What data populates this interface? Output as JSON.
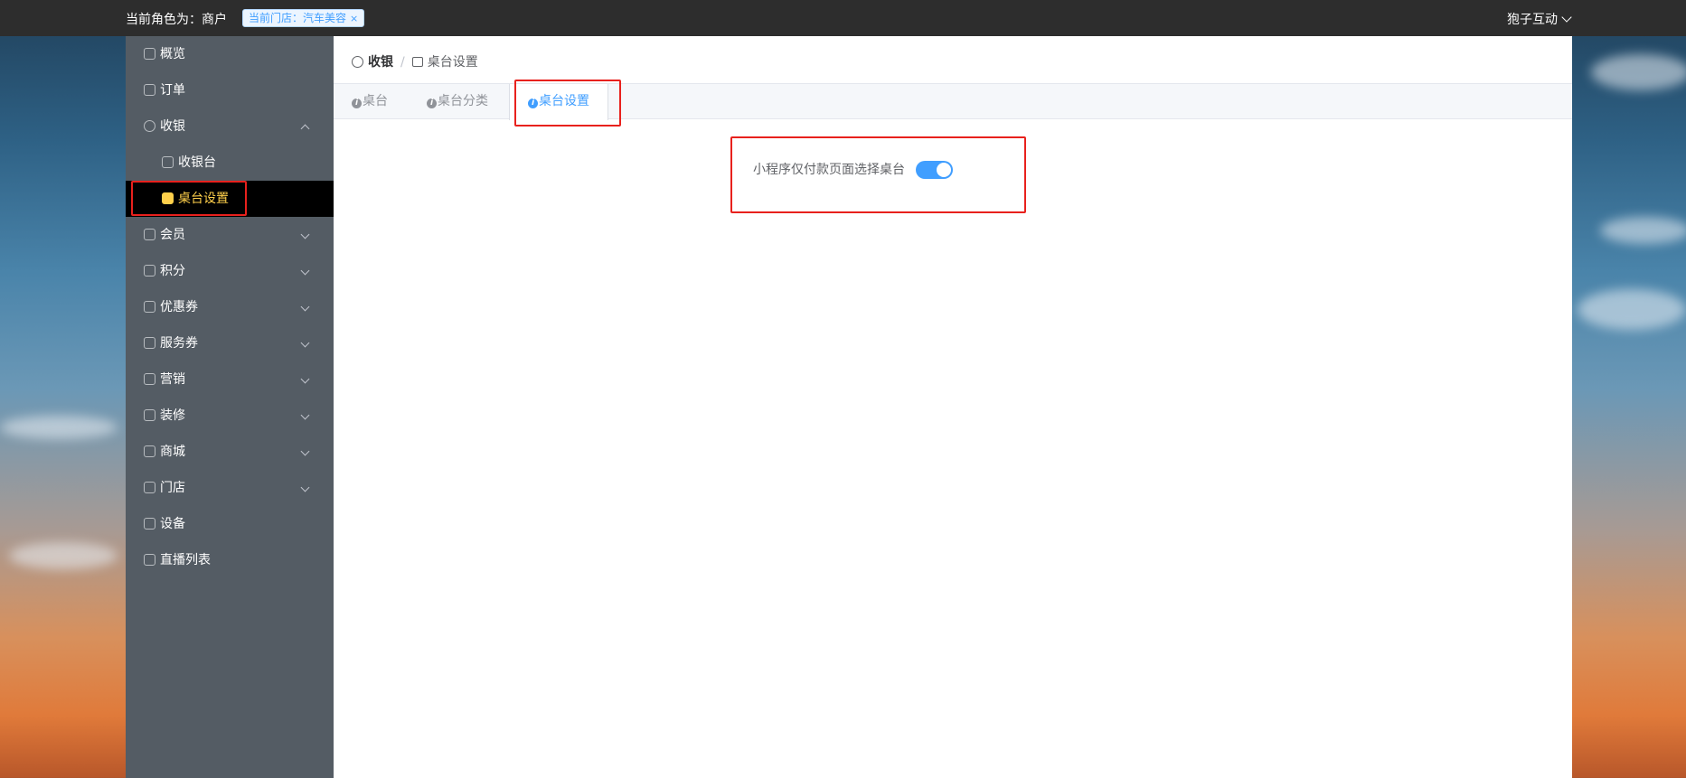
{
  "topbar": {
    "role_text": "当前角色为：商户",
    "store_tag": "当前门店：汽车美容",
    "store_tag_close": "×",
    "user_name": "狍子互动"
  },
  "sidebar": {
    "items": [
      {
        "label": "概览",
        "icon": "home-icon"
      },
      {
        "label": "订单",
        "icon": "order-icon"
      },
      {
        "label": "收银",
        "icon": "cashier-icon",
        "expanded": true
      },
      {
        "label": "收银台",
        "icon": "register-icon"
      },
      {
        "label": "桌台设置",
        "icon": "table-icon",
        "active": true
      },
      {
        "label": "会员",
        "icon": "member-icon"
      },
      {
        "label": "积分",
        "icon": "points-icon"
      },
      {
        "label": "优惠券",
        "icon": "coupon-icon"
      },
      {
        "label": "服务券",
        "icon": "service-coupon-icon"
      },
      {
        "label": "营销",
        "icon": "marketing-icon"
      },
      {
        "label": "装修",
        "icon": "decoration-icon"
      },
      {
        "label": "商城",
        "icon": "mall-icon"
      },
      {
        "label": "门店",
        "icon": "store-icon"
      },
      {
        "label": "设备",
        "icon": "device-icon"
      },
      {
        "label": "直播列表",
        "icon": "live-list-icon"
      }
    ]
  },
  "breadcrumb": {
    "first": "收银",
    "separator": "/",
    "last": "桌台设置"
  },
  "tabs": [
    {
      "label": "桌台",
      "icon_glyph": "i"
    },
    {
      "label": "桌台分类",
      "icon_glyph": "i"
    },
    {
      "label": "桌台设置",
      "icon_glyph": "i",
      "active": true
    }
  ],
  "settings": {
    "mini_program_label": "小程序仅付款页面选择桌台",
    "mini_program_enabled": true
  },
  "colors": {
    "accent": "#409eff",
    "active_menu_text": "#ffd04b",
    "highlight_box": "#e8211d",
    "sidebar_bg": "#545c64",
    "topbar_bg": "#2d2d2d"
  }
}
